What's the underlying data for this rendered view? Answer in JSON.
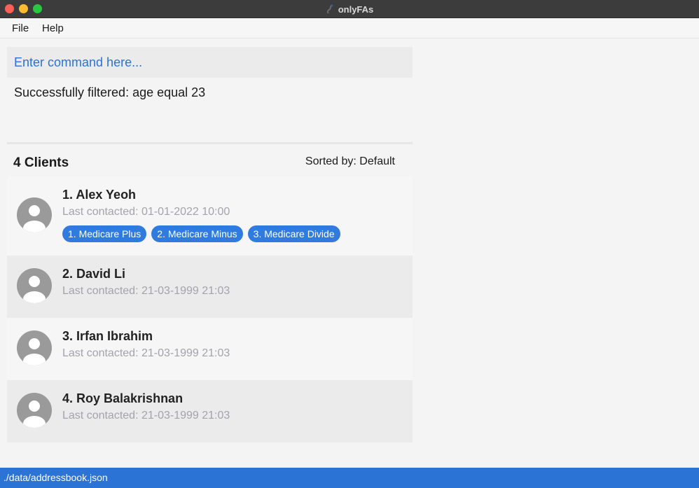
{
  "window": {
    "title": "onlyFAs"
  },
  "menu": {
    "file_label": "File",
    "help_label": "Help"
  },
  "command": {
    "placeholder": "Enter command here..."
  },
  "result": {
    "message": "Successfully filtered: age equal 23"
  },
  "list": {
    "count_label": "4 Clients",
    "sort_label": "Sorted by: Default",
    "clients": [
      {
        "name": "1.  Alex Yeoh",
        "last_contacted": "Last contacted: 01-01-2022 10:00",
        "policies": [
          "1. Medicare Plus",
          "2. Medicare Minus",
          "3. Medicare Divide"
        ]
      },
      {
        "name": "2.  David Li",
        "last_contacted": "Last contacted: 21-03-1999 21:03",
        "policies": []
      },
      {
        "name": "3.  Irfan Ibrahim",
        "last_contacted": "Last contacted: 21-03-1999 21:03",
        "policies": []
      },
      {
        "name": "4.  Roy Balakrishnan",
        "last_contacted": "Last contacted: 21-03-1999 21:03",
        "policies": []
      }
    ]
  },
  "status": {
    "path": "./data/addressbook.json"
  },
  "colors": {
    "accent": "#2b73d4",
    "tag": "#2f7be0"
  }
}
